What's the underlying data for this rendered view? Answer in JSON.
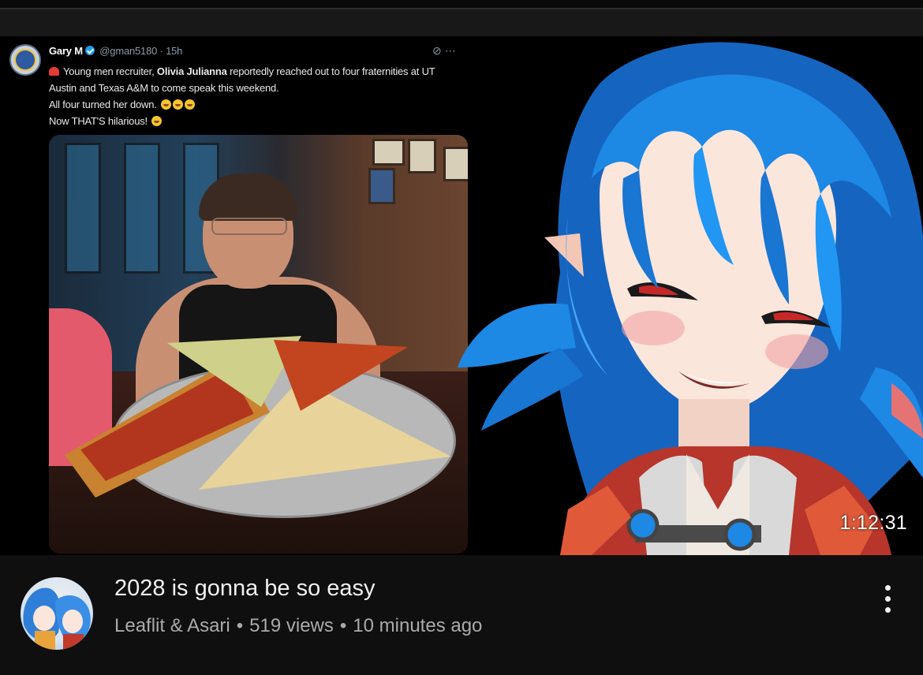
{
  "thumbnail": {
    "duration": "1:12:31",
    "tweet": {
      "name": "Gary M",
      "handle": "@gman5180",
      "time": "15h",
      "line1_pre": "Young men recruiter, ",
      "line1_bold": "Olivia Julianna",
      "line1_post": " reportedly reached out to four fraternities at UT Austin and Texas A&M to come speak this weekend.",
      "line2": "All four turned her down.",
      "line3": "Now THAT'S hilarious!"
    }
  },
  "video": {
    "title": "2028 is gonna be so easy",
    "channel": "Leaflit & Asari",
    "views": "519 views",
    "age": "10 minutes ago",
    "separator": "•"
  },
  "colors": {
    "background": "#0f0f0f",
    "title_text": "#f1f1f1",
    "meta_text": "#aaaaaa",
    "character_hair": "#1e88e5"
  },
  "icons": [
    "verified-icon",
    "siren-emoji-icon",
    "rofl-emoji-icon",
    "more-options-icon",
    "grok-icon"
  ]
}
